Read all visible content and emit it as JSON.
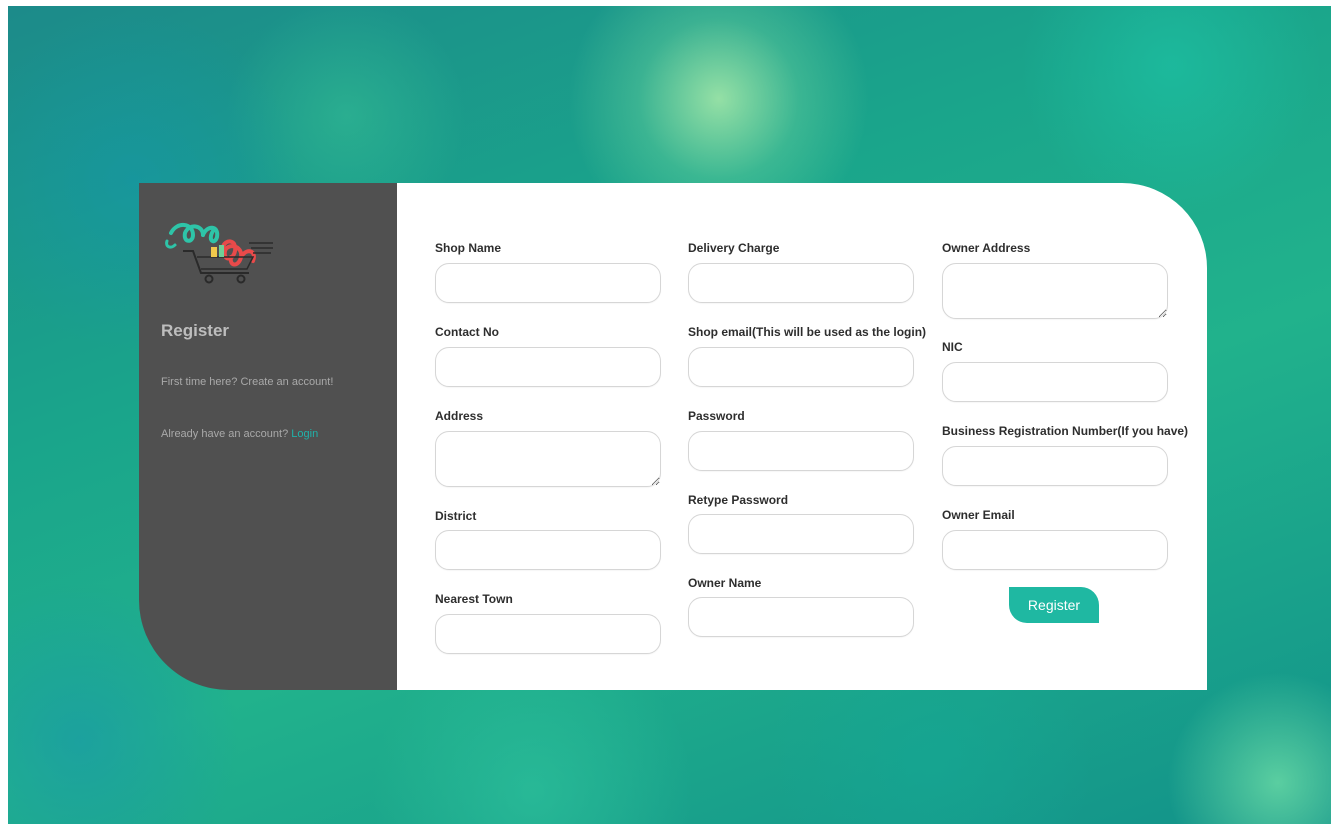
{
  "sidebar": {
    "title": "Register",
    "first_time_text": "First time here? Create an account!",
    "already_text": "Already have an account?",
    "login_link": "Login",
    "logo_icon": "shop-cart-logo"
  },
  "form": {
    "shop_name_label": "Shop Name",
    "contact_no_label": "Contact No",
    "address_label": "Address",
    "district_label": "District",
    "nearest_town_label": "Nearest Town",
    "delivery_charge_label": "Delivery Charge",
    "shop_email_label": "Shop email(This will be used as the login)",
    "password_label": "Password",
    "retype_password_label": "Retype Password",
    "owner_name_label": "Owner Name",
    "owner_address_label": "Owner Address",
    "nic_label": "NIC",
    "business_reg_label": "Business Registration Number(If you have)",
    "owner_email_label": "Owner Email",
    "submit_label": "Register"
  },
  "colors": {
    "accent": "#1fb8a2",
    "sidebar_bg": "#505050",
    "link": "#20b2aa"
  }
}
